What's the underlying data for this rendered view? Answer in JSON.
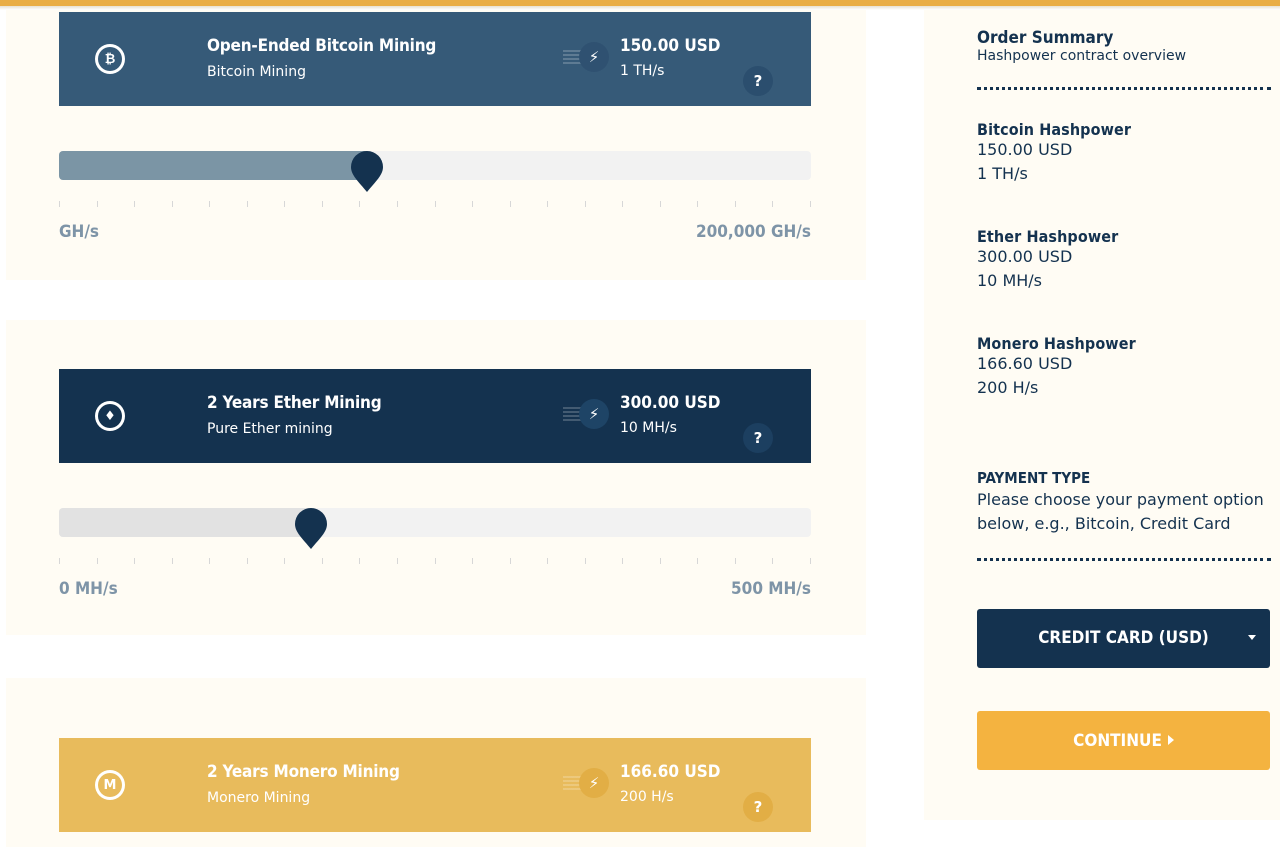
{
  "plans": {
    "bitcoin": {
      "title": "Open-Ended Bitcoin Mining",
      "subtitle": "Bitcoin Mining",
      "price": "150.00 USD",
      "rate": "1 TH/s",
      "help": "?",
      "coin_symbol": "₿",
      "slider_min_label": "GH/s",
      "slider_max_label": "200,000 GH/s",
      "slider_fraction": 0.41
    },
    "ether": {
      "title": "2 Years Ether Mining",
      "subtitle": "Pure Ether mining",
      "price": "300.00 USD",
      "rate": "10 MH/s",
      "help": "?",
      "coin_symbol": "♦",
      "slider_min_label": "0 MH/s",
      "slider_max_label": "500 MH/s",
      "slider_fraction": 0.335
    },
    "monero": {
      "title": "2 Years Monero Mining",
      "subtitle": "Monero Mining",
      "price": "166.60 USD",
      "rate": "200 H/s",
      "help": "?",
      "coin_symbol": "M"
    }
  },
  "summary": {
    "title": "Order Summary",
    "subtitle": "Hashpower contract overview",
    "items": [
      {
        "name": "Bitcoin Hashpower",
        "price": "150.00 USD",
        "rate": "1 TH/s"
      },
      {
        "name": "Ether Hashpower",
        "price": "300.00 USD",
        "rate": "10 MH/s"
      },
      {
        "name": "Monero Hashpower",
        "price": "166.60 USD",
        "rate": "200 H/s"
      }
    ],
    "payment_title": "PAYMENT TYPE",
    "payment_desc": "Please choose your payment option below, e.g., Bitcoin, Credit Card",
    "payment_selected": "CREDIT CARD (USD)",
    "continue_label": "CONTINUE"
  },
  "colors": {
    "accent": "#e9ad45",
    "navy": "#14324f",
    "steel": "#365a78",
    "gold": "#e8bb5c"
  }
}
